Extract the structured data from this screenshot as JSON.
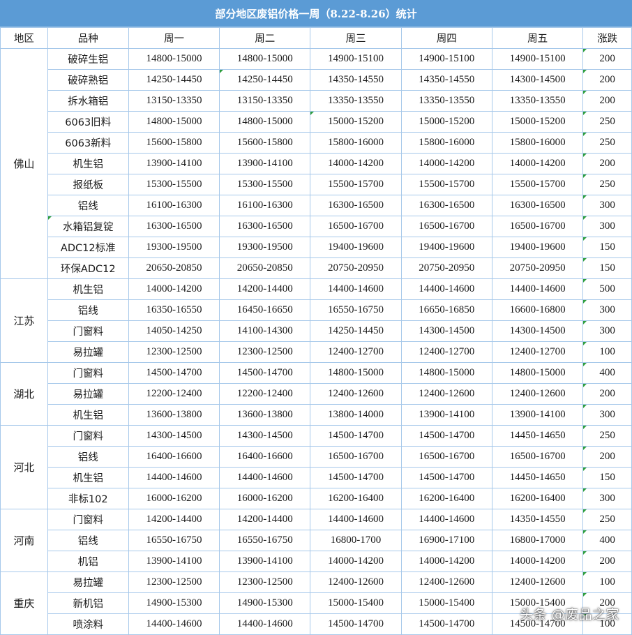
{
  "title": "部分地区废铝价格一周（8.22-8.26）统计",
  "colors": {
    "title_bg": "#5b9bd5",
    "grid": "#a6c8ea",
    "comment_flag": "#2e9e3e"
  },
  "headers": [
    "地区",
    "品种",
    "周一",
    "周二",
    "周三",
    "周四",
    "周五",
    "涨跌"
  ],
  "regions": [
    {
      "name": "佛山",
      "rows": [
        {
          "variety": "破碎生铝",
          "prices": [
            "14800-15000",
            "14800-15000",
            "14900-15100",
            "14900-15100",
            "14900-15100"
          ],
          "change": "200"
        },
        {
          "variety": "破碎熟铝",
          "prices": [
            "14250-14450",
            "14250-14450",
            "14350-14550",
            "14350-14550",
            "14300-14500"
          ],
          "change": "200"
        },
        {
          "variety": "拆水箱铝",
          "prices": [
            "13150-13350",
            "13150-13350",
            "13350-13550",
            "13350-13550",
            "13350-13550"
          ],
          "change": "200"
        },
        {
          "variety": "6063旧料",
          "prices": [
            "14800-15000",
            "14800-15000",
            "15000-15200",
            "15000-15200",
            "15000-15200"
          ],
          "change": "250"
        },
        {
          "variety": "6063新料",
          "prices": [
            "15600-15800",
            "15600-15800",
            "15800-16000",
            "15800-16000",
            "15800-16000"
          ],
          "change": "250"
        },
        {
          "variety": "机生铝",
          "prices": [
            "13900-14100",
            "13900-14100",
            "14000-14200",
            "14000-14200",
            "14000-14200"
          ],
          "change": "200"
        },
        {
          "variety": "报纸板",
          "prices": [
            "15300-15500",
            "15300-15500",
            "15500-15700",
            "15500-15700",
            "15500-15700"
          ],
          "change": "250"
        },
        {
          "variety": "铝线",
          "prices": [
            "16100-16300",
            "16100-16300",
            "16300-16500",
            "16300-16500",
            "16300-16500"
          ],
          "change": "300"
        },
        {
          "variety": "水箱铝复锭",
          "prices": [
            "16300-16500",
            "16300-16500",
            "16500-16700",
            "16500-16700",
            "16500-16700"
          ],
          "change": "300"
        },
        {
          "variety": "ADC12标准",
          "prices": [
            "19300-19500",
            "19300-19500",
            "19400-19600",
            "19400-19600",
            "19400-19600"
          ],
          "change": "150"
        },
        {
          "variety": "环保ADC12",
          "prices": [
            "20650-20850",
            "20650-20850",
            "20750-20950",
            "20750-20950",
            "20750-20950"
          ],
          "change": "150"
        }
      ]
    },
    {
      "name": "江苏",
      "rows": [
        {
          "variety": "机生铝",
          "prices": [
            "14000-14200",
            "14200-14400",
            "14400-14600",
            "14400-14600",
            "14400-14600"
          ],
          "change": "500"
        },
        {
          "variety": "铝线",
          "prices": [
            "16350-16550",
            "16450-16650",
            "16550-16750",
            "16650-16850",
            "16600-16800"
          ],
          "change": "300"
        },
        {
          "variety": "门窗料",
          "prices": [
            "14050-14250",
            "14100-14300",
            "14250-14450",
            "14300-14500",
            "14300-14500"
          ],
          "change": "300"
        },
        {
          "variety": "易拉罐",
          "prices": [
            "12300-12500",
            "12300-12500",
            "12400-12700",
            "12400-12700",
            "12400-12700"
          ],
          "change": "100"
        }
      ]
    },
    {
      "name": "湖北",
      "rows": [
        {
          "variety": "门窗料",
          "prices": [
            "14500-14700",
            "14500-14700",
            "14800-15000",
            "14800-15000",
            "14800-15000"
          ],
          "change": "400"
        },
        {
          "variety": "易拉罐",
          "prices": [
            "12200-12400",
            "12200-12400",
            "12400-12600",
            "12400-12600",
            "12400-12600"
          ],
          "change": "200"
        },
        {
          "variety": "机生铝",
          "prices": [
            "13600-13800",
            "13600-13800",
            "13800-14000",
            "13900-14100",
            "13900-14100"
          ],
          "change": "300"
        }
      ]
    },
    {
      "name": "河北",
      "rows": [
        {
          "variety": "门窗料",
          "prices": [
            "14300-14500",
            "14300-14500",
            "14500-14700",
            "14500-14700",
            "14450-14650"
          ],
          "change": "250"
        },
        {
          "variety": "铝线",
          "prices": [
            "16400-16600",
            "16400-16600",
            "16500-16700",
            "16500-16700",
            "16500-16700"
          ],
          "change": "200"
        },
        {
          "variety": "机生铝",
          "prices": [
            "14400-14600",
            "14400-14600",
            "14500-14700",
            "14500-14700",
            "14450-14650"
          ],
          "change": "150"
        },
        {
          "variety": "非标102",
          "prices": [
            "16000-16200",
            "16000-16200",
            "16200-16400",
            "16200-16400",
            "16200-16400"
          ],
          "change": "300"
        }
      ]
    },
    {
      "name": "河南",
      "rows": [
        {
          "variety": "门窗料",
          "prices": [
            "14200-14400",
            "14200-14400",
            "14400-14600",
            "14400-14600",
            "14350-14550"
          ],
          "change": "250"
        },
        {
          "variety": "铝线",
          "prices": [
            "16550-16750",
            "16550-16750",
            "16800-1700",
            "16900-17100",
            "16800-17000"
          ],
          "change": "400"
        },
        {
          "variety": "机铝",
          "prices": [
            "13900-14100",
            "13900-14100",
            "14000-14200",
            "14000-14200",
            "14000-14200"
          ],
          "change": "200"
        }
      ]
    },
    {
      "name": "重庆",
      "rows": [
        {
          "variety": "易拉罐",
          "prices": [
            "12300-12500",
            "12300-12500",
            "12400-12600",
            "12400-12600",
            "12400-12600"
          ],
          "change": "100"
        },
        {
          "variety": "新机铝",
          "prices": [
            "14900-15300",
            "14900-15300",
            "15000-15400",
            "15000-15400",
            "15000-15400"
          ],
          "change": "200"
        },
        {
          "variety": "喷涂料",
          "prices": [
            "14400-14600",
            "14400-14600",
            "14500-14700",
            "14500-14700",
            "14500-14700"
          ],
          "change": "100"
        }
      ]
    }
  ],
  "watermark": "头条 @废品之家"
}
